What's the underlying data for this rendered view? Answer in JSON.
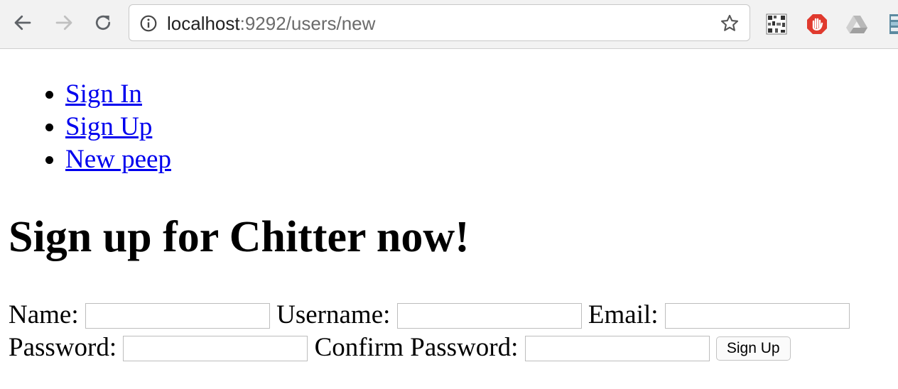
{
  "browser": {
    "url_host": "localhost",
    "url_rest": ":9292/users/new",
    "icons": [
      "back-arrow-icon",
      "forward-arrow-icon",
      "reload-icon",
      "info-icon",
      "bookmark-star-icon",
      "qr-extension-icon",
      "adblock-extension-icon",
      "google-drive-extension-icon",
      "tab-extension-icon"
    ]
  },
  "nav": {
    "items": [
      {
        "label": "Sign In"
      },
      {
        "label": "Sign Up"
      },
      {
        "label": "New peep"
      }
    ]
  },
  "main": {
    "title": "Sign up for Chitter now!"
  },
  "form": {
    "name_label": "Name:",
    "name_value": "",
    "username_label": "Username:",
    "username_value": "",
    "email_label": "Email:",
    "email_value": "",
    "password_label": "Password:",
    "password_value": "",
    "confirm_label": "Confirm Password:",
    "confirm_value": "",
    "submit_label": "Sign Up"
  },
  "colors": {
    "link": "#0000ee",
    "toolbar_bg": "#f2f2f2",
    "adblock_red": "#e03a2e"
  }
}
